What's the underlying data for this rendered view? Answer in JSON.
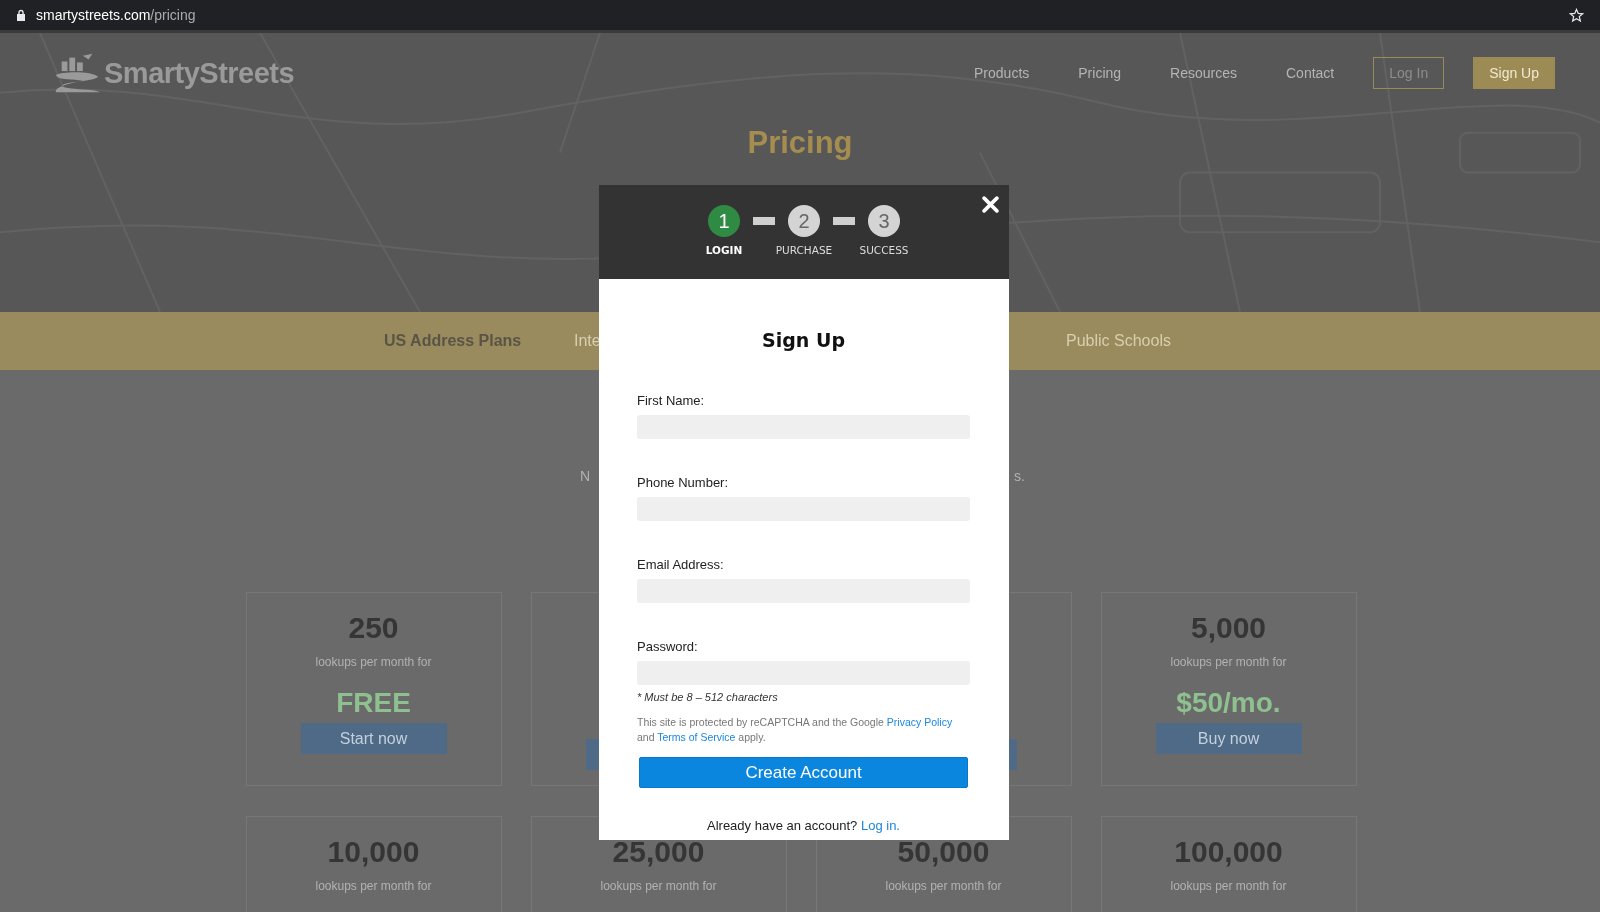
{
  "browser": {
    "url_domain": "smartystreets.com",
    "url_path": "/pricing"
  },
  "header": {
    "logo": "SmartyStreets",
    "nav": [
      "Products",
      "Pricing",
      "Resources",
      "Contact"
    ],
    "login": "Log In",
    "signup": "Sign Up"
  },
  "hero": {
    "title": "Pricing"
  },
  "plan_tabs": [
    {
      "label": "US Address Plans",
      "selected": true
    },
    {
      "label": "Inte",
      "selected": false
    },
    {
      "label": "Public Schools",
      "selected": false
    }
  ],
  "intro_fragments": [
    "N",
    "s."
  ],
  "plans": [
    {
      "kind": "full",
      "amount": "250",
      "caption": "lookups per month for",
      "price": "FREE",
      "button": "Start now"
    },
    {
      "kind": "covered"
    },
    {
      "kind": "covered"
    },
    {
      "kind": "full",
      "amount": "5,000",
      "caption": "lookups per month for",
      "price": "$50/mo.",
      "button": "Buy now"
    },
    {
      "kind": "amount_only",
      "amount": "10,000",
      "caption": "lookups per month for"
    },
    {
      "kind": "amount_only",
      "amount": "25,000",
      "caption": "lookups per month for"
    },
    {
      "kind": "amount_only",
      "amount": "50,000",
      "caption": "lookups per month for"
    },
    {
      "kind": "amount_only",
      "amount": "100,000",
      "caption": "lookups per month for"
    }
  ],
  "modal": {
    "steps": [
      {
        "number": "1",
        "label": "LOGIN",
        "selected": true
      },
      {
        "number": "2",
        "label": "PURCHASE",
        "selected": false
      },
      {
        "number": "3",
        "label": "SUCCESS",
        "selected": false
      }
    ],
    "title": "Sign Up",
    "fields": [
      {
        "label": "First Name:"
      },
      {
        "label": "Phone Number:"
      },
      {
        "label": "Email Address:"
      },
      {
        "label": "Password:",
        "hint": "* Must be 8 – 512 characters"
      }
    ],
    "recaptcha": {
      "before": "This site is protected by reCAPTCHA and the Google",
      "link1": "Privacy Policy",
      "middle": "and",
      "link2": "Terms of Service",
      "after": "apply."
    },
    "submit": "Create Account",
    "footer": {
      "text": "Already have an account?",
      "link": "Log in."
    }
  }
}
